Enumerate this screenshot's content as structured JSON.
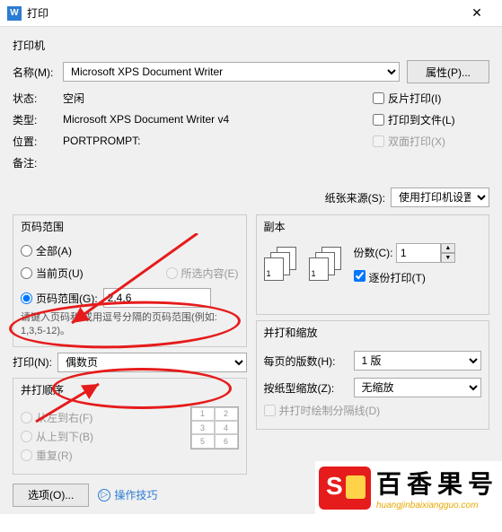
{
  "window": {
    "title": "打印"
  },
  "printer": {
    "section": "打印机",
    "name_label": "名称(M):",
    "name_value": "Microsoft XPS Document Writer",
    "properties_btn": "属性(P)...",
    "status_label": "状态:",
    "status_value": "空闲",
    "type_label": "类型:",
    "type_value": "Microsoft XPS Document Writer v4",
    "where_label": "位置:",
    "where_value": "PORTPROMPT:",
    "comment_label": "备注:",
    "reverse_label": "反片打印(I)",
    "tofile_label": "打印到文件(L)",
    "duplex_label": "双面打印(X)"
  },
  "paper": {
    "label": "纸张来源(S):",
    "value": "使用打印机设置"
  },
  "range": {
    "title": "页码范围",
    "all": "全部(A)",
    "current": "当前页(U)",
    "selection": "所选内容(E)",
    "pages": "页码范围(G):",
    "pages_value": "2,4,6",
    "hint": "请键入页码和/或用逗号分隔的页码范围(例如: 1,3,5-12)。"
  },
  "copies": {
    "title": "副本",
    "count_label": "份数(C):",
    "count_value": "1",
    "collate_label": "逐份打印(T)"
  },
  "print_what": {
    "label": "打印(N):",
    "value": "偶数页"
  },
  "order": {
    "title": "并打顺序",
    "lr": "从左到右(F)",
    "tb": "从上到下(B)",
    "repeat": "重复(R)"
  },
  "scale": {
    "title": "并打和缩放",
    "pps_label": "每页的版数(H):",
    "pps_value": "1 版",
    "fit_label": "按纸型缩放(Z):",
    "fit_value": "无缩放",
    "draw_lines": "并打时绘制分隔线(D)"
  },
  "footer": {
    "options_btn": "选项(O)...",
    "tips": "操作技巧"
  },
  "watermark": {
    "main": "百香果号",
    "sub": "huangjinbaixiangguo.com"
  }
}
